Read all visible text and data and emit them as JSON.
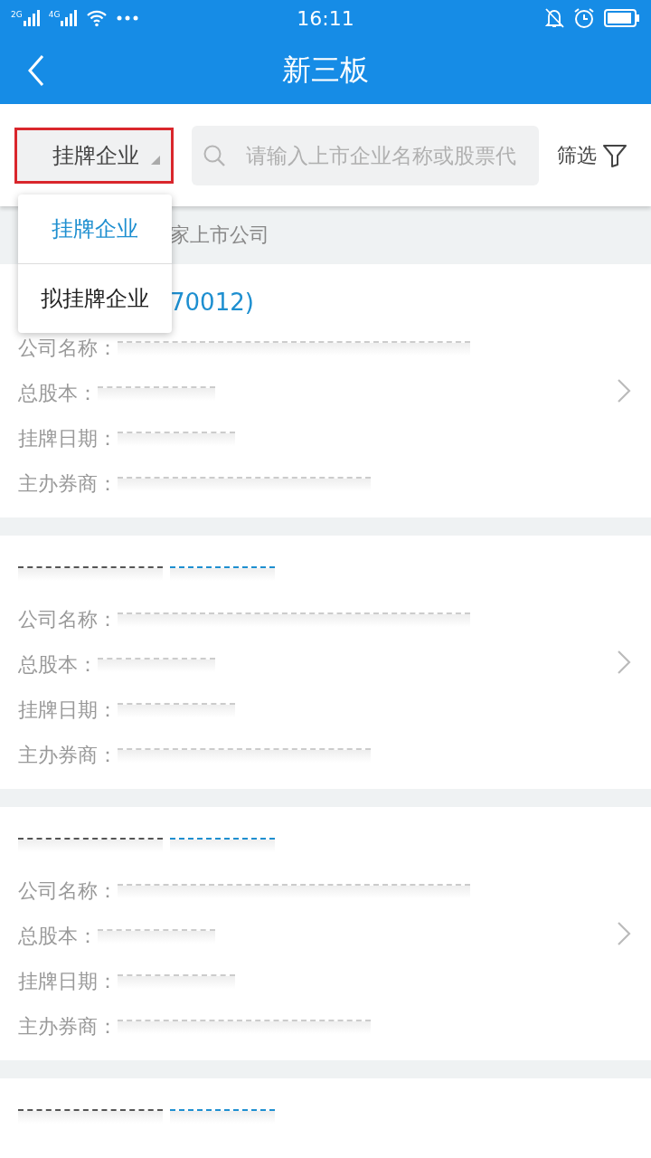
{
  "status_bar": {
    "networks": [
      "2G",
      "4G"
    ],
    "time": "16:11"
  },
  "nav": {
    "title": "新三板"
  },
  "filter_bar": {
    "type_selector": {
      "label": "挂牌企业",
      "highlighted": true
    },
    "search": {
      "placeholder": "请输入上市企业名称或股票代"
    },
    "filter": {
      "label": "筛选"
    }
  },
  "summary": "家上市公司",
  "companies": [
    {
      "code": "70012)",
      "code_obscured": false,
      "fields": [
        {
          "label": "公司名称：",
          "value_obscured": true
        },
        {
          "label": "总股本：",
          "value_obscured": true
        },
        {
          "label": "挂牌日期：",
          "value_obscured": true
        },
        {
          "label": "主办券商：",
          "value_obscured": true
        }
      ]
    },
    {
      "name_obscured": true,
      "code_obscured": true,
      "fields": [
        {
          "label": "公司名称：",
          "value_obscured": true
        },
        {
          "label": "总股本：",
          "value_obscured": true
        },
        {
          "label": "挂牌日期：",
          "value_obscured": true
        },
        {
          "label": "主办券商：",
          "value_obscured": true
        }
      ]
    },
    {
      "name_obscured": true,
      "code_obscured": true,
      "fields": [
        {
          "label": "公司名称：",
          "value_obscured": true
        },
        {
          "label": "总股本：",
          "value_obscured": true
        },
        {
          "label": "挂牌日期：",
          "value_obscured": true
        },
        {
          "label": "主办券商：",
          "value_obscured": true
        }
      ]
    },
    {
      "name_obscured": true,
      "code_obscured": true
    }
  ],
  "dropdown": [
    {
      "label": "挂牌企业",
      "selected": true
    },
    {
      "label": "拟挂牌企业",
      "selected": false
    }
  ]
}
